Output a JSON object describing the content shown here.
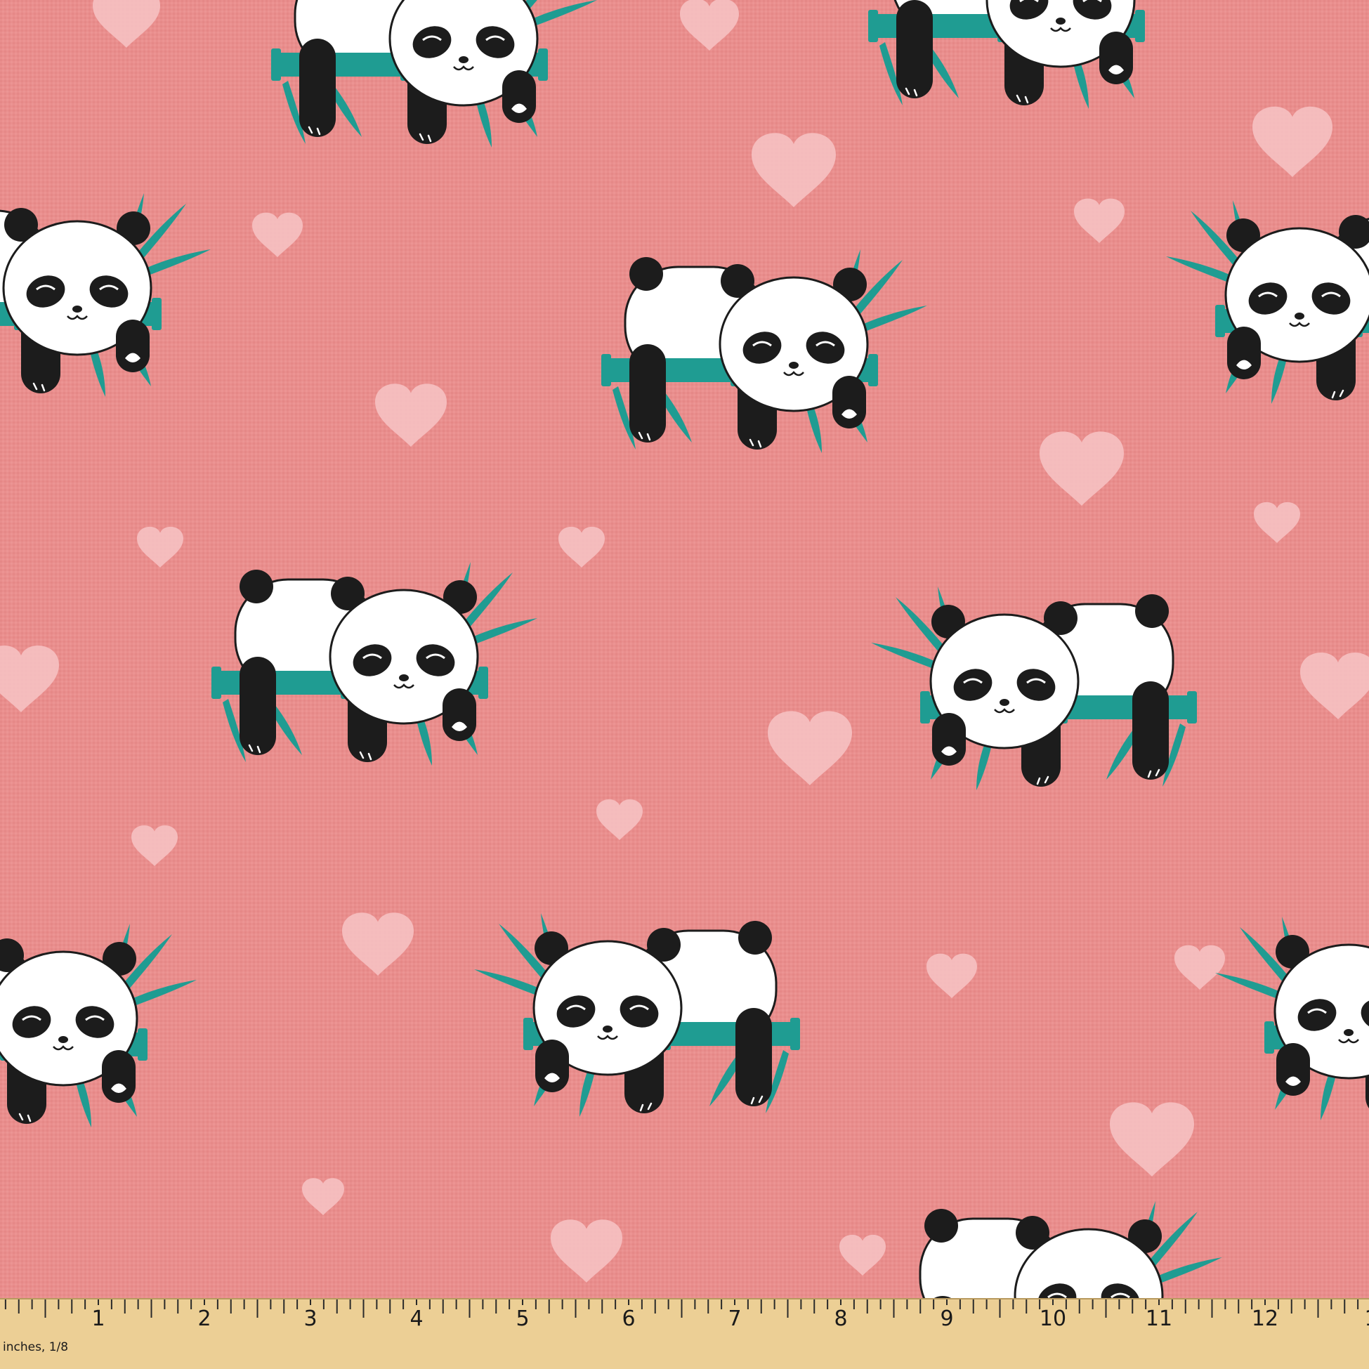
{
  "image": {
    "subject": "pink fabric swatch with panda pattern",
    "colors": {
      "background": "#e98e8d",
      "heart": "#f7c4c6",
      "panda_white": "#ffffff",
      "panda_black": "#1c1c1c",
      "bamboo": "#1f9c92",
      "ruler": "#eccf95"
    }
  },
  "ruler": {
    "unit_label": "inches, 1/8",
    "numbers": [
      "1",
      "2",
      "3",
      "4",
      "5",
      "6",
      "7",
      "8",
      "9",
      "10",
      "11",
      "12",
      "1"
    ]
  }
}
